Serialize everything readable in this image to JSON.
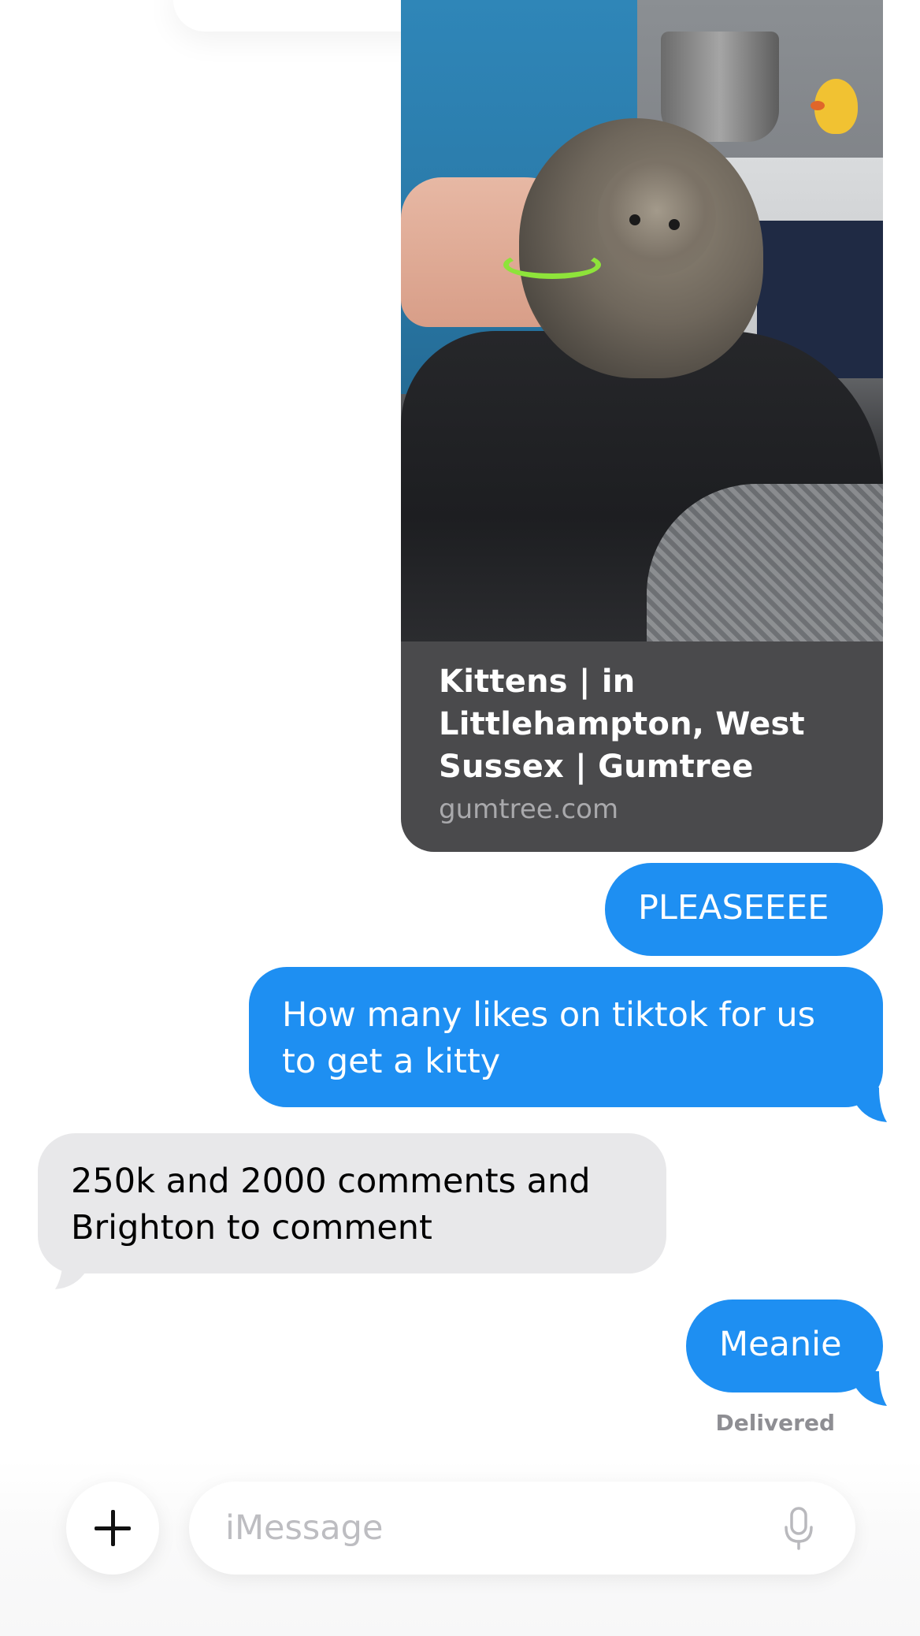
{
  "link_preview": {
    "title": "Kittens | in Littlehampton, West Sussex | Gumtree",
    "domain": "gumtree.com",
    "image_icon": "kitten-photo"
  },
  "messages": [
    {
      "direction": "outgoing",
      "text": "PLEASEEEE"
    },
    {
      "direction": "outgoing",
      "text": "How many likes on tiktok for us to get a kitty"
    },
    {
      "direction": "incoming",
      "text": "250k and 2000 comments and Brighton to comment"
    },
    {
      "direction": "outgoing",
      "text": "Meanie"
    }
  ],
  "status": {
    "delivered": "Delivered"
  },
  "composer": {
    "placeholder": "iMessage",
    "plus_icon": "plus-icon",
    "mic_icon": "microphone-icon"
  },
  "colors": {
    "outgoing_bubble": "#1e8ff2",
    "incoming_bubble": "#e8e8ea",
    "link_card_bg": "#4a4a4c",
    "placeholder": "#bdbdc1",
    "status_text": "#8e8e93"
  }
}
